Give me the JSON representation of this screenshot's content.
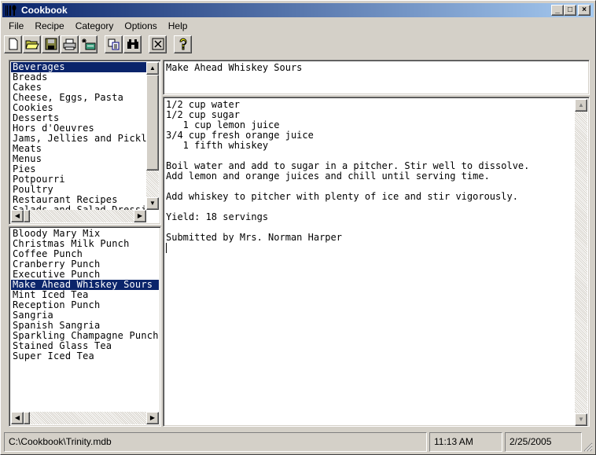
{
  "window": {
    "title": "Cookbook",
    "controls": {
      "minimize": "_",
      "maximize": "□",
      "close": "×"
    }
  },
  "menu": [
    "File",
    "Recipe",
    "Category",
    "Options",
    "Help"
  ],
  "toolbar": [
    {
      "name": "new-icon"
    },
    {
      "name": "open-folder-icon"
    },
    {
      "name": "save-icon"
    },
    {
      "name": "print-icon"
    },
    {
      "name": "new-recipe-icon"
    },
    {
      "name": "copy-icon"
    },
    {
      "name": "find-binoculars-icon"
    },
    {
      "name": "delete-icon"
    },
    {
      "name": "help-icon"
    }
  ],
  "categories": {
    "items": [
      "Beverages",
      "Breads",
      "Cakes",
      "Cheese, Eggs, Pasta",
      "Cookies",
      "Desserts",
      "Hors d'Oeuvres",
      "Jams, Jellies and Pickles",
      "Meats",
      "Menus",
      "Pies",
      "Potpourri",
      "Poultry",
      "Restaurant Recipes",
      "Salads and Salad Dressings"
    ],
    "selected": "Beverages"
  },
  "recipes": {
    "items": [
      "Bloody Mary Mix",
      "Christmas Milk Punch",
      "Coffee Punch",
      "Cranberry Punch",
      "Executive Punch",
      "Make Ahead Whiskey Sours",
      "Mint Iced Tea",
      "Reception Punch",
      "Sangria",
      "Spanish Sangria",
      "Sparkling Champagne Punch",
      "Stained Glass Tea",
      "Super Iced Tea"
    ],
    "selected": "Make Ahead Whiskey Sours"
  },
  "recipe_title": "Make Ahead Whiskey Sours",
  "recipe_body": "1/2 cup water\n1/2 cup sugar\n   1 cup lemon juice\n3/4 cup fresh orange juice\n   1 fifth whiskey\n\nBoil water and add to sugar in a pitcher. Stir well to dissolve.\nAdd lemon and orange juices and chill until serving time.\n\nAdd whiskey to pitcher with plenty of ice and stir vigorously.\n\nYield: 18 servings\n\nSubmitted by Mrs. Norman Harper\n",
  "status": {
    "path": "C:\\Cookbook\\Trinity.mdb",
    "time": "11:13 AM",
    "date": "2/25/2005"
  },
  "colors": {
    "selection": "#0a246a",
    "face": "#d4d0c8"
  }
}
